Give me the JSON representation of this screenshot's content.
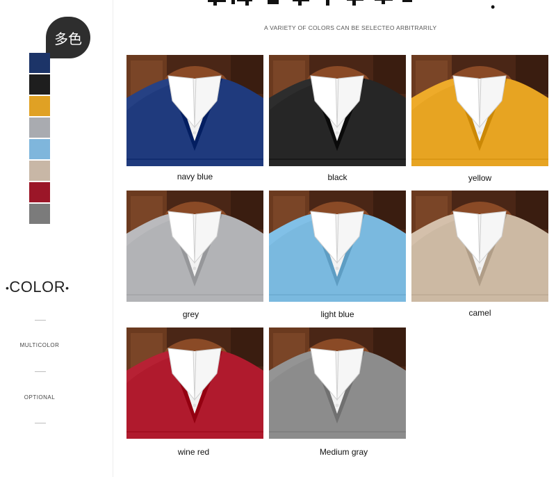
{
  "sidebar": {
    "badge_text": "多色",
    "swatches": [
      {
        "color": "#1c3468"
      },
      {
        "color": "#1e1e1e"
      },
      {
        "color": "#e0a124"
      },
      {
        "color": "#a9abb0"
      },
      {
        "color": "#7fb6dc"
      },
      {
        "color": "#c8b7a6"
      },
      {
        "color": "#9b1628"
      },
      {
        "color": "#7b7b7b"
      }
    ],
    "section_title": "COLOR",
    "options": [
      "MULTICOLOR",
      "OPTIONAL"
    ]
  },
  "header": {
    "subtitle": "A VARIETY OF COLORS CAN BE SELECTEO ARBITRARILY"
  },
  "products": [
    {
      "label": "navy blue",
      "color": "#1f3a7d"
    },
    {
      "label": "black",
      "color": "#262626"
    },
    {
      "label": "yellow",
      "color": "#e7a422"
    },
    {
      "label": "grey",
      "color": "#b2b3b6"
    },
    {
      "label": "light blue",
      "color": "#7ab9df"
    },
    {
      "label": "camel",
      "color": "#ccb9a3"
    },
    {
      "label": "wine red",
      "color": "#b01a2d"
    },
    {
      "label": "Medium gray",
      "color": "#8c8c8c"
    }
  ]
}
